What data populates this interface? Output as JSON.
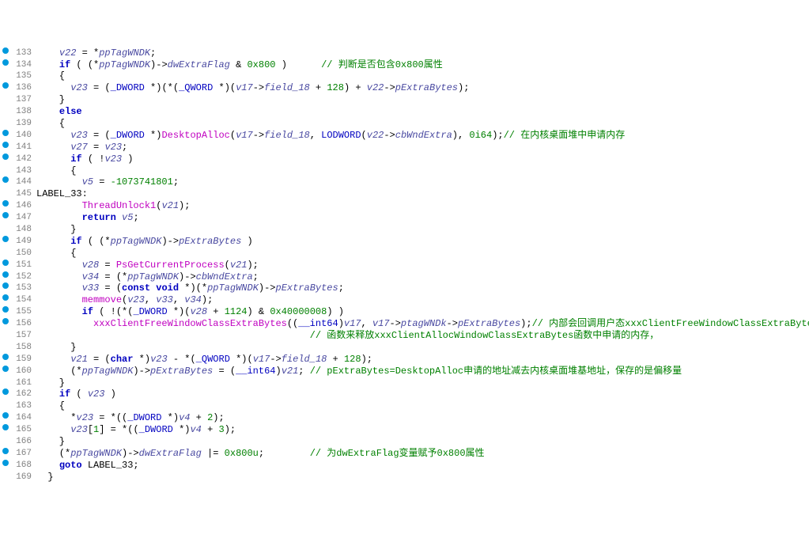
{
  "lines": [
    {
      "ln": 133,
      "bp": true,
      "segs": [
        {
          "c": "plain",
          "t": "    "
        },
        {
          "c": "ident",
          "t": "v22"
        },
        {
          "c": "plain",
          "t": " = *"
        },
        {
          "c": "ident",
          "t": "ppTagWNDK"
        },
        {
          "c": "plain",
          "t": ";"
        }
      ]
    },
    {
      "ln": 134,
      "bp": true,
      "segs": [
        {
          "c": "plain",
          "t": "    "
        },
        {
          "c": "kw",
          "t": "if"
        },
        {
          "c": "plain",
          "t": " ( (*"
        },
        {
          "c": "ident",
          "t": "ppTagWNDK"
        },
        {
          "c": "plain",
          "t": ")->"
        },
        {
          "c": "ident",
          "t": "dwExtraFlag"
        },
        {
          "c": "plain",
          "t": " & "
        },
        {
          "c": "num",
          "t": "0x800"
        },
        {
          "c": "plain",
          "t": " )      "
        },
        {
          "c": "comment",
          "t": "// 判断是否包含0x800属性"
        }
      ]
    },
    {
      "ln": 135,
      "bp": false,
      "segs": [
        {
          "c": "plain",
          "t": "    {"
        }
      ]
    },
    {
      "ln": 136,
      "bp": true,
      "segs": [
        {
          "c": "plain",
          "t": "      "
        },
        {
          "c": "ident",
          "t": "v23"
        },
        {
          "c": "plain",
          "t": " = ("
        },
        {
          "c": "type",
          "t": "_DWORD"
        },
        {
          "c": "plain",
          "t": " *)(*("
        },
        {
          "c": "type",
          "t": "_QWORD"
        },
        {
          "c": "plain",
          "t": " *)("
        },
        {
          "c": "ident",
          "t": "v17"
        },
        {
          "c": "plain",
          "t": "->"
        },
        {
          "c": "ident",
          "t": "field_18"
        },
        {
          "c": "plain",
          "t": " + "
        },
        {
          "c": "num",
          "t": "128"
        },
        {
          "c": "plain",
          "t": ") + "
        },
        {
          "c": "ident",
          "t": "v22"
        },
        {
          "c": "plain",
          "t": "->"
        },
        {
          "c": "ident",
          "t": "pExtraBytes"
        },
        {
          "c": "plain",
          "t": ");"
        }
      ]
    },
    {
      "ln": 137,
      "bp": false,
      "segs": [
        {
          "c": "plain",
          "t": "    }"
        }
      ]
    },
    {
      "ln": 138,
      "bp": false,
      "segs": [
        {
          "c": "plain",
          "t": "    "
        },
        {
          "c": "kw",
          "t": "else"
        }
      ]
    },
    {
      "ln": 139,
      "bp": false,
      "segs": [
        {
          "c": "plain",
          "t": "    {"
        }
      ]
    },
    {
      "ln": 140,
      "bp": true,
      "segs": [
        {
          "c": "plain",
          "t": "      "
        },
        {
          "c": "ident",
          "t": "v23"
        },
        {
          "c": "plain",
          "t": " = ("
        },
        {
          "c": "type",
          "t": "_DWORD"
        },
        {
          "c": "plain",
          "t": " *)"
        },
        {
          "c": "func",
          "t": "DesktopAlloc"
        },
        {
          "c": "plain",
          "t": "("
        },
        {
          "c": "ident",
          "t": "v17"
        },
        {
          "c": "plain",
          "t": "->"
        },
        {
          "c": "ident",
          "t": "field_18"
        },
        {
          "c": "plain",
          "t": ", "
        },
        {
          "c": "type",
          "t": "LODWORD"
        },
        {
          "c": "plain",
          "t": "("
        },
        {
          "c": "ident",
          "t": "v22"
        },
        {
          "c": "plain",
          "t": "->"
        },
        {
          "c": "ident",
          "t": "cbWndExtra"
        },
        {
          "c": "plain",
          "t": "), "
        },
        {
          "c": "num",
          "t": "0i64"
        },
        {
          "c": "plain",
          "t": ");"
        },
        {
          "c": "comment",
          "t": "// 在内核桌面堆中申请内存"
        }
      ]
    },
    {
      "ln": 141,
      "bp": true,
      "segs": [
        {
          "c": "plain",
          "t": "      "
        },
        {
          "c": "ident",
          "t": "v27"
        },
        {
          "c": "plain",
          "t": " = "
        },
        {
          "c": "ident",
          "t": "v23"
        },
        {
          "c": "plain",
          "t": ";"
        }
      ]
    },
    {
      "ln": 142,
      "bp": true,
      "segs": [
        {
          "c": "plain",
          "t": "      "
        },
        {
          "c": "kw",
          "t": "if"
        },
        {
          "c": "plain",
          "t": " ( !"
        },
        {
          "c": "ident",
          "t": "v23"
        },
        {
          "c": "plain",
          "t": " )"
        }
      ]
    },
    {
      "ln": 143,
      "bp": false,
      "segs": [
        {
          "c": "plain",
          "t": "      {"
        }
      ]
    },
    {
      "ln": 144,
      "bp": true,
      "segs": [
        {
          "c": "plain",
          "t": "        "
        },
        {
          "c": "ident",
          "t": "v5"
        },
        {
          "c": "plain",
          "t": " = "
        },
        {
          "c": "num",
          "t": "-1073741801"
        },
        {
          "c": "plain",
          "t": ";"
        }
      ]
    },
    {
      "ln": 145,
      "bp": false,
      "segs": [
        {
          "c": "plain",
          "t": "LABEL_33:"
        }
      ]
    },
    {
      "ln": 146,
      "bp": true,
      "segs": [
        {
          "c": "plain",
          "t": "        "
        },
        {
          "c": "func",
          "t": "ThreadUnlock1"
        },
        {
          "c": "plain",
          "t": "("
        },
        {
          "c": "ident",
          "t": "v21"
        },
        {
          "c": "plain",
          "t": ");"
        }
      ]
    },
    {
      "ln": 147,
      "bp": true,
      "segs": [
        {
          "c": "plain",
          "t": "        "
        },
        {
          "c": "kw",
          "t": "return"
        },
        {
          "c": "plain",
          "t": " "
        },
        {
          "c": "ident",
          "t": "v5"
        },
        {
          "c": "plain",
          "t": ";"
        }
      ]
    },
    {
      "ln": 148,
      "bp": false,
      "segs": [
        {
          "c": "plain",
          "t": "      }"
        }
      ]
    },
    {
      "ln": 149,
      "bp": true,
      "segs": [
        {
          "c": "plain",
          "t": "      "
        },
        {
          "c": "kw",
          "t": "if"
        },
        {
          "c": "plain",
          "t": " ( (*"
        },
        {
          "c": "ident",
          "t": "ppTagWNDK"
        },
        {
          "c": "plain",
          "t": ")->"
        },
        {
          "c": "ident",
          "t": "pExtraBytes"
        },
        {
          "c": "plain",
          "t": " )"
        }
      ]
    },
    {
      "ln": 150,
      "bp": false,
      "segs": [
        {
          "c": "plain",
          "t": "      {"
        }
      ]
    },
    {
      "ln": 151,
      "bp": true,
      "segs": [
        {
          "c": "plain",
          "t": "        "
        },
        {
          "c": "ident",
          "t": "v28"
        },
        {
          "c": "plain",
          "t": " = "
        },
        {
          "c": "func",
          "t": "PsGetCurrentProcess"
        },
        {
          "c": "plain",
          "t": "("
        },
        {
          "c": "ident",
          "t": "v21"
        },
        {
          "c": "plain",
          "t": ");"
        }
      ]
    },
    {
      "ln": 152,
      "bp": true,
      "segs": [
        {
          "c": "plain",
          "t": "        "
        },
        {
          "c": "ident",
          "t": "v34"
        },
        {
          "c": "plain",
          "t": " = (*"
        },
        {
          "c": "ident",
          "t": "ppTagWNDK"
        },
        {
          "c": "plain",
          "t": ")->"
        },
        {
          "c": "ident",
          "t": "cbWndExtra"
        },
        {
          "c": "plain",
          "t": ";"
        }
      ]
    },
    {
      "ln": 153,
      "bp": true,
      "segs": [
        {
          "c": "plain",
          "t": "        "
        },
        {
          "c": "ident",
          "t": "v33"
        },
        {
          "c": "plain",
          "t": " = ("
        },
        {
          "c": "kw",
          "t": "const"
        },
        {
          "c": "plain",
          "t": " "
        },
        {
          "c": "kw",
          "t": "void"
        },
        {
          "c": "plain",
          "t": " *)(*"
        },
        {
          "c": "ident",
          "t": "ppTagWNDK"
        },
        {
          "c": "plain",
          "t": ")->"
        },
        {
          "c": "ident",
          "t": "pExtraBytes"
        },
        {
          "c": "plain",
          "t": ";"
        }
      ]
    },
    {
      "ln": 154,
      "bp": true,
      "segs": [
        {
          "c": "plain",
          "t": "        "
        },
        {
          "c": "func",
          "t": "memmove"
        },
        {
          "c": "plain",
          "t": "("
        },
        {
          "c": "ident",
          "t": "v23"
        },
        {
          "c": "plain",
          "t": ", "
        },
        {
          "c": "ident",
          "t": "v33"
        },
        {
          "c": "plain",
          "t": ", "
        },
        {
          "c": "ident",
          "t": "v34"
        },
        {
          "c": "plain",
          "t": ");"
        }
      ]
    },
    {
      "ln": 155,
      "bp": true,
      "segs": [
        {
          "c": "plain",
          "t": "        "
        },
        {
          "c": "kw",
          "t": "if"
        },
        {
          "c": "plain",
          "t": " ( !(*("
        },
        {
          "c": "type",
          "t": "_DWORD"
        },
        {
          "c": "plain",
          "t": " *)("
        },
        {
          "c": "ident",
          "t": "v28"
        },
        {
          "c": "plain",
          "t": " + "
        },
        {
          "c": "num",
          "t": "1124"
        },
        {
          "c": "plain",
          "t": ") & "
        },
        {
          "c": "num",
          "t": "0x40000008"
        },
        {
          "c": "plain",
          "t": ") )"
        }
      ]
    },
    {
      "ln": 156,
      "bp": true,
      "segs": [
        {
          "c": "plain",
          "t": "          "
        },
        {
          "c": "func",
          "t": "xxxClientFreeWindowClassExtraBytes"
        },
        {
          "c": "plain",
          "t": "(("
        },
        {
          "c": "type",
          "t": "__int64"
        },
        {
          "c": "plain",
          "t": ")"
        },
        {
          "c": "ident",
          "t": "v17"
        },
        {
          "c": "plain",
          "t": ", "
        },
        {
          "c": "ident",
          "t": "v17"
        },
        {
          "c": "plain",
          "t": "->"
        },
        {
          "c": "ident",
          "t": "ptagWNDk"
        },
        {
          "c": "plain",
          "t": "->"
        },
        {
          "c": "ident",
          "t": "pExtraBytes"
        },
        {
          "c": "plain",
          "t": ");"
        },
        {
          "c": "comment",
          "t": "// 内部会回调用户态xxxClientFreeWindowClassExtraBytes"
        }
      ]
    },
    {
      "ln": 157,
      "bp": false,
      "segs": [
        {
          "c": "plain",
          "t": "                                                "
        },
        {
          "c": "comment",
          "t": "// 函数来释放xxxClientAllocWindowClassExtraBytes函数中申请的内存，"
        }
      ]
    },
    {
      "ln": 158,
      "bp": false,
      "segs": [
        {
          "c": "plain",
          "t": "      }"
        }
      ]
    },
    {
      "ln": 159,
      "bp": true,
      "segs": [
        {
          "c": "plain",
          "t": "      "
        },
        {
          "c": "ident",
          "t": "v21"
        },
        {
          "c": "plain",
          "t": " = ("
        },
        {
          "c": "kw",
          "t": "char"
        },
        {
          "c": "plain",
          "t": " *)"
        },
        {
          "c": "ident",
          "t": "v23"
        },
        {
          "c": "plain",
          "t": " - *("
        },
        {
          "c": "type",
          "t": "_QWORD"
        },
        {
          "c": "plain",
          "t": " *)("
        },
        {
          "c": "ident",
          "t": "v17"
        },
        {
          "c": "plain",
          "t": "->"
        },
        {
          "c": "ident",
          "t": "field_18"
        },
        {
          "c": "plain",
          "t": " + "
        },
        {
          "c": "num",
          "t": "128"
        },
        {
          "c": "plain",
          "t": ");"
        }
      ]
    },
    {
      "ln": 160,
      "bp": true,
      "segs": [
        {
          "c": "plain",
          "t": "      (*"
        },
        {
          "c": "ident",
          "t": "ppTagWNDK"
        },
        {
          "c": "plain",
          "t": ")->"
        },
        {
          "c": "ident",
          "t": "pExtraBytes"
        },
        {
          "c": "plain",
          "t": " = ("
        },
        {
          "c": "type",
          "t": "__int64"
        },
        {
          "c": "plain",
          "t": ")"
        },
        {
          "c": "ident",
          "t": "v21"
        },
        {
          "c": "plain",
          "t": "; "
        },
        {
          "c": "comment",
          "t": "// pExtraBytes=DesktopAlloc申请的地址减去内核桌面堆基地址，保存的是偏移量"
        }
      ]
    },
    {
      "ln": 161,
      "bp": false,
      "segs": [
        {
          "c": "plain",
          "t": "    }"
        }
      ]
    },
    {
      "ln": 162,
      "bp": true,
      "segs": [
        {
          "c": "plain",
          "t": "    "
        },
        {
          "c": "kw",
          "t": "if"
        },
        {
          "c": "plain",
          "t": " ( "
        },
        {
          "c": "ident",
          "t": "v23"
        },
        {
          "c": "plain",
          "t": " )"
        }
      ]
    },
    {
      "ln": 163,
      "bp": false,
      "segs": [
        {
          "c": "plain",
          "t": "    {"
        }
      ]
    },
    {
      "ln": 164,
      "bp": true,
      "segs": [
        {
          "c": "plain",
          "t": "      *"
        },
        {
          "c": "ident",
          "t": "v23"
        },
        {
          "c": "plain",
          "t": " = *(("
        },
        {
          "c": "type",
          "t": "_DWORD"
        },
        {
          "c": "plain",
          "t": " *)"
        },
        {
          "c": "ident",
          "t": "v4"
        },
        {
          "c": "plain",
          "t": " + "
        },
        {
          "c": "num",
          "t": "2"
        },
        {
          "c": "plain",
          "t": ");"
        }
      ]
    },
    {
      "ln": 165,
      "bp": true,
      "segs": [
        {
          "c": "plain",
          "t": "      "
        },
        {
          "c": "ident",
          "t": "v23"
        },
        {
          "c": "plain",
          "t": "["
        },
        {
          "c": "num",
          "t": "1"
        },
        {
          "c": "plain",
          "t": "] = *(("
        },
        {
          "c": "type",
          "t": "_DWORD"
        },
        {
          "c": "plain",
          "t": " *)"
        },
        {
          "c": "ident",
          "t": "v4"
        },
        {
          "c": "plain",
          "t": " + "
        },
        {
          "c": "num",
          "t": "3"
        },
        {
          "c": "plain",
          "t": ");"
        }
      ]
    },
    {
      "ln": 166,
      "bp": false,
      "segs": [
        {
          "c": "plain",
          "t": "    }"
        }
      ]
    },
    {
      "ln": 167,
      "bp": true,
      "segs": [
        {
          "c": "plain",
          "t": "    (*"
        },
        {
          "c": "ident",
          "t": "ppTagWNDK"
        },
        {
          "c": "plain",
          "t": ")->"
        },
        {
          "c": "ident",
          "t": "dwExtraFlag"
        },
        {
          "c": "plain",
          "t": " |= "
        },
        {
          "c": "num",
          "t": "0x800u"
        },
        {
          "c": "plain",
          "t": ";        "
        },
        {
          "c": "comment",
          "t": "// 为dwExtraFlag变量赋予0x800属性"
        }
      ]
    },
    {
      "ln": 168,
      "bp": true,
      "segs": [
        {
          "c": "plain",
          "t": "    "
        },
        {
          "c": "kw",
          "t": "goto"
        },
        {
          "c": "plain",
          "t": " LABEL_33;"
        }
      ]
    },
    {
      "ln": 169,
      "bp": false,
      "segs": [
        {
          "c": "plain",
          "t": "  }"
        }
      ]
    }
  ]
}
